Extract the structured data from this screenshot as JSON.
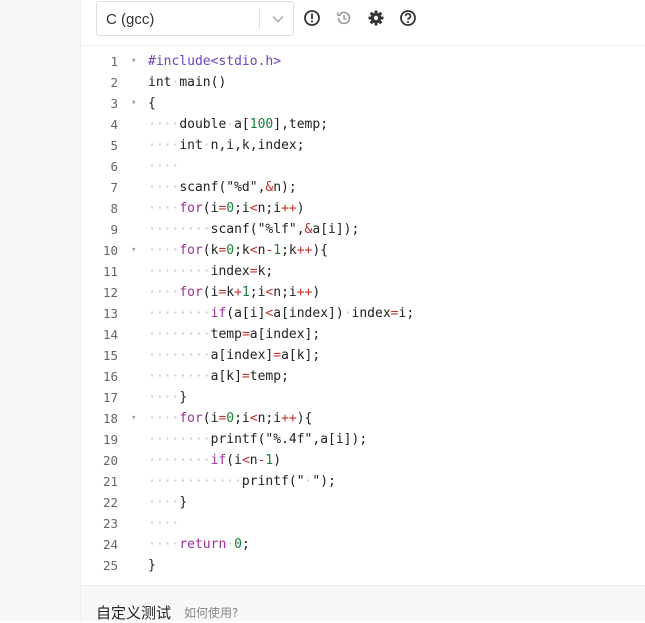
{
  "toolbar": {
    "language": "C (gcc)",
    "icons": [
      "exclamation-circle-icon",
      "history-icon",
      "gear-icon",
      "question-circle-icon"
    ]
  },
  "editor": {
    "lines": [
      {
        "num": "1",
        "fold": "▾",
        "tokens": [
          [
            "pp",
            "#include<stdio.h>"
          ]
        ]
      },
      {
        "num": "2",
        "fold": "",
        "tokens": [
          [
            "plain",
            "int"
          ],
          [
            "ws",
            "·"
          ],
          [
            "plain",
            "main()"
          ]
        ]
      },
      {
        "num": "3",
        "fold": "▾",
        "tokens": [
          [
            "plain",
            "{"
          ]
        ]
      },
      {
        "num": "4",
        "fold": "",
        "tokens": [
          [
            "ws",
            "····"
          ],
          [
            "plain",
            "double"
          ],
          [
            "ws",
            "·"
          ],
          [
            "plain",
            "a["
          ],
          [
            "num",
            "100"
          ],
          [
            "plain",
            "],temp;"
          ]
        ]
      },
      {
        "num": "5",
        "fold": "",
        "tokens": [
          [
            "ws",
            "····"
          ],
          [
            "plain",
            "int"
          ],
          [
            "ws",
            "·"
          ],
          [
            "plain",
            "n,i,k,index;"
          ]
        ]
      },
      {
        "num": "6",
        "fold": "",
        "tokens": [
          [
            "ws",
            "····"
          ]
        ]
      },
      {
        "num": "7",
        "fold": "",
        "tokens": [
          [
            "ws",
            "····"
          ],
          [
            "plain",
            "scanf(\"%d\","
          ],
          [
            "op",
            "&"
          ],
          [
            "plain",
            "n);"
          ]
        ]
      },
      {
        "num": "8",
        "fold": "",
        "tokens": [
          [
            "ws",
            "····"
          ],
          [
            "kw",
            "for"
          ],
          [
            "plain",
            "(i"
          ],
          [
            "op",
            "="
          ],
          [
            "num",
            "0"
          ],
          [
            "plain",
            ";i"
          ],
          [
            "op",
            "<"
          ],
          [
            "plain",
            "n;i"
          ],
          [
            "op",
            "++"
          ],
          [
            "plain",
            ")"
          ]
        ]
      },
      {
        "num": "9",
        "fold": "",
        "tokens": [
          [
            "ws",
            "········"
          ],
          [
            "plain",
            "scanf(\"%lf\","
          ],
          [
            "op",
            "&"
          ],
          [
            "plain",
            "a[i]);"
          ]
        ]
      },
      {
        "num": "10",
        "fold": "▾",
        "tokens": [
          [
            "ws",
            "····"
          ],
          [
            "kw",
            "for"
          ],
          [
            "plain",
            "(k"
          ],
          [
            "op",
            "="
          ],
          [
            "num",
            "0"
          ],
          [
            "plain",
            ";k"
          ],
          [
            "op",
            "<"
          ],
          [
            "plain",
            "n"
          ],
          [
            "op",
            "-"
          ],
          [
            "num",
            "1"
          ],
          [
            "plain",
            ";k"
          ],
          [
            "op",
            "++"
          ],
          [
            "plain",
            "){"
          ]
        ]
      },
      {
        "num": "11",
        "fold": "",
        "tokens": [
          [
            "ws",
            "········"
          ],
          [
            "plain",
            "index"
          ],
          [
            "op",
            "="
          ],
          [
            "plain",
            "k;"
          ]
        ]
      },
      {
        "num": "12",
        "fold": "",
        "tokens": [
          [
            "ws",
            "····"
          ],
          [
            "kw",
            "for"
          ],
          [
            "plain",
            "(i"
          ],
          [
            "op",
            "="
          ],
          [
            "plain",
            "k"
          ],
          [
            "op",
            "+"
          ],
          [
            "num",
            "1"
          ],
          [
            "plain",
            ";i"
          ],
          [
            "op",
            "<"
          ],
          [
            "plain",
            "n;i"
          ],
          [
            "op",
            "++"
          ],
          [
            "plain",
            ")"
          ]
        ]
      },
      {
        "num": "13",
        "fold": "",
        "tokens": [
          [
            "ws",
            "········"
          ],
          [
            "kw",
            "if"
          ],
          [
            "plain",
            "(a[i]"
          ],
          [
            "op",
            "<"
          ],
          [
            "plain",
            "a[index])"
          ],
          [
            "ws",
            "·"
          ],
          [
            "plain",
            "index"
          ],
          [
            "op",
            "="
          ],
          [
            "plain",
            "i;"
          ]
        ]
      },
      {
        "num": "14",
        "fold": "",
        "tokens": [
          [
            "ws",
            "········"
          ],
          [
            "plain",
            "temp"
          ],
          [
            "op",
            "="
          ],
          [
            "plain",
            "a[index];"
          ]
        ]
      },
      {
        "num": "15",
        "fold": "",
        "tokens": [
          [
            "ws",
            "········"
          ],
          [
            "plain",
            "a[index]"
          ],
          [
            "op",
            "="
          ],
          [
            "plain",
            "a[k];"
          ]
        ]
      },
      {
        "num": "16",
        "fold": "",
        "tokens": [
          [
            "ws",
            "········"
          ],
          [
            "plain",
            "a[k]"
          ],
          [
            "op",
            "="
          ],
          [
            "plain",
            "temp;"
          ]
        ]
      },
      {
        "num": "17",
        "fold": "",
        "tokens": [
          [
            "ws",
            "····"
          ],
          [
            "plain",
            "}"
          ]
        ]
      },
      {
        "num": "18",
        "fold": "▾",
        "tokens": [
          [
            "ws",
            "····"
          ],
          [
            "kw",
            "for"
          ],
          [
            "plain",
            "(i"
          ],
          [
            "op",
            "="
          ],
          [
            "num",
            "0"
          ],
          [
            "plain",
            ";i"
          ],
          [
            "op",
            "<"
          ],
          [
            "plain",
            "n;i"
          ],
          [
            "op",
            "++"
          ],
          [
            "plain",
            "){"
          ]
        ]
      },
      {
        "num": "19",
        "fold": "",
        "tokens": [
          [
            "ws",
            "········"
          ],
          [
            "plain",
            "printf(\"%.4f\",a[i]);"
          ]
        ]
      },
      {
        "num": "20",
        "fold": "",
        "tokens": [
          [
            "ws",
            "········"
          ],
          [
            "kw",
            "if"
          ],
          [
            "plain",
            "(i"
          ],
          [
            "op",
            "<"
          ],
          [
            "plain",
            "n"
          ],
          [
            "op",
            "-"
          ],
          [
            "num",
            "1"
          ],
          [
            "plain",
            ")"
          ]
        ]
      },
      {
        "num": "21",
        "fold": "",
        "tokens": [
          [
            "ws",
            "············"
          ],
          [
            "plain",
            "printf(\""
          ],
          [
            "ws",
            "·"
          ],
          [
            "plain",
            "\");"
          ]
        ]
      },
      {
        "num": "22",
        "fold": "",
        "tokens": [
          [
            "ws",
            "····"
          ],
          [
            "plain",
            "}"
          ]
        ]
      },
      {
        "num": "23",
        "fold": "",
        "tokens": [
          [
            "ws",
            "····"
          ]
        ]
      },
      {
        "num": "24",
        "fold": "",
        "tokens": [
          [
            "ws",
            "····"
          ],
          [
            "kw",
            "return"
          ],
          [
            "ws",
            "·"
          ],
          [
            "num",
            "0"
          ],
          [
            "plain",
            ";"
          ]
        ]
      },
      {
        "num": "25",
        "fold": "",
        "tokens": [
          [
            "plain",
            "}"
          ]
        ]
      }
    ]
  },
  "footer": {
    "custom_test": "自定义测试",
    "how_to_use": "如何使用?"
  },
  "colors": {
    "preprocessor": "#6f42c1",
    "keyword": "#9d2f9b",
    "operator": "#c4302b",
    "number": "#1a7f37",
    "whitespace": "#c8c8c8"
  }
}
